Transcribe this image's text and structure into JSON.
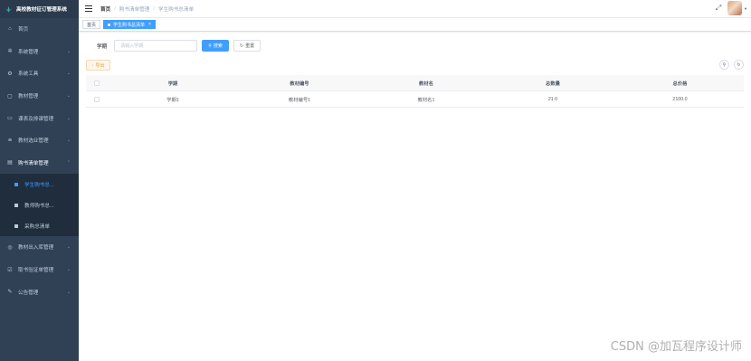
{
  "brand": {
    "title": "高校教材征订管理系统"
  },
  "sidebar": {
    "items": [
      {
        "label": "首页",
        "icon": "home-icon",
        "has_children": false
      },
      {
        "label": "系统管理",
        "icon": "gear-icon",
        "has_children": true
      },
      {
        "label": "系统工具",
        "icon": "tool-icon",
        "has_children": true
      },
      {
        "label": "教材管理",
        "icon": "book-icon",
        "has_children": true
      },
      {
        "label": "课表及排课管理",
        "icon": "calendar-icon",
        "has_children": true
      },
      {
        "label": "教材选业管理",
        "icon": "stack-icon",
        "has_children": true
      },
      {
        "label": "购书清单管理",
        "icon": "list-icon",
        "has_children": true,
        "open": true,
        "children": [
          {
            "label": "学生购书总...",
            "active": true
          },
          {
            "label": "教师购书总...",
            "active": false
          },
          {
            "label": "采购总清单",
            "active": false
          }
        ]
      },
      {
        "label": "教材出入库管理",
        "icon": "box-icon",
        "has_children": true
      },
      {
        "label": "取书验证单管理",
        "icon": "check-icon",
        "has_children": true
      },
      {
        "label": "公告管理",
        "icon": "edit-icon",
        "has_children": true
      }
    ]
  },
  "breadcrumb": [
    "首页",
    "购书清单管理",
    "学生购书总清单"
  ],
  "tags": [
    {
      "label": "首页",
      "active": false
    },
    {
      "label": "学生购书总清单",
      "active": true
    }
  ],
  "search": {
    "label": "学期",
    "placeholder": "请输入学期",
    "search_button": "搜索",
    "reset_button": "重置"
  },
  "toolbar": {
    "export_label": "导出"
  },
  "table": {
    "columns": [
      "学期",
      "教材编号",
      "教材名",
      "总数量",
      "总价格"
    ],
    "rows": [
      [
        "学期1",
        "教材编号1",
        "教材名1",
        "21.0",
        "2100.0"
      ]
    ]
  },
  "watermark": "CSDN @加瓦程序设计师",
  "colors": {
    "sidebar_bg": "#304156",
    "accent": "#409eff",
    "warning": "#e6a23c"
  }
}
